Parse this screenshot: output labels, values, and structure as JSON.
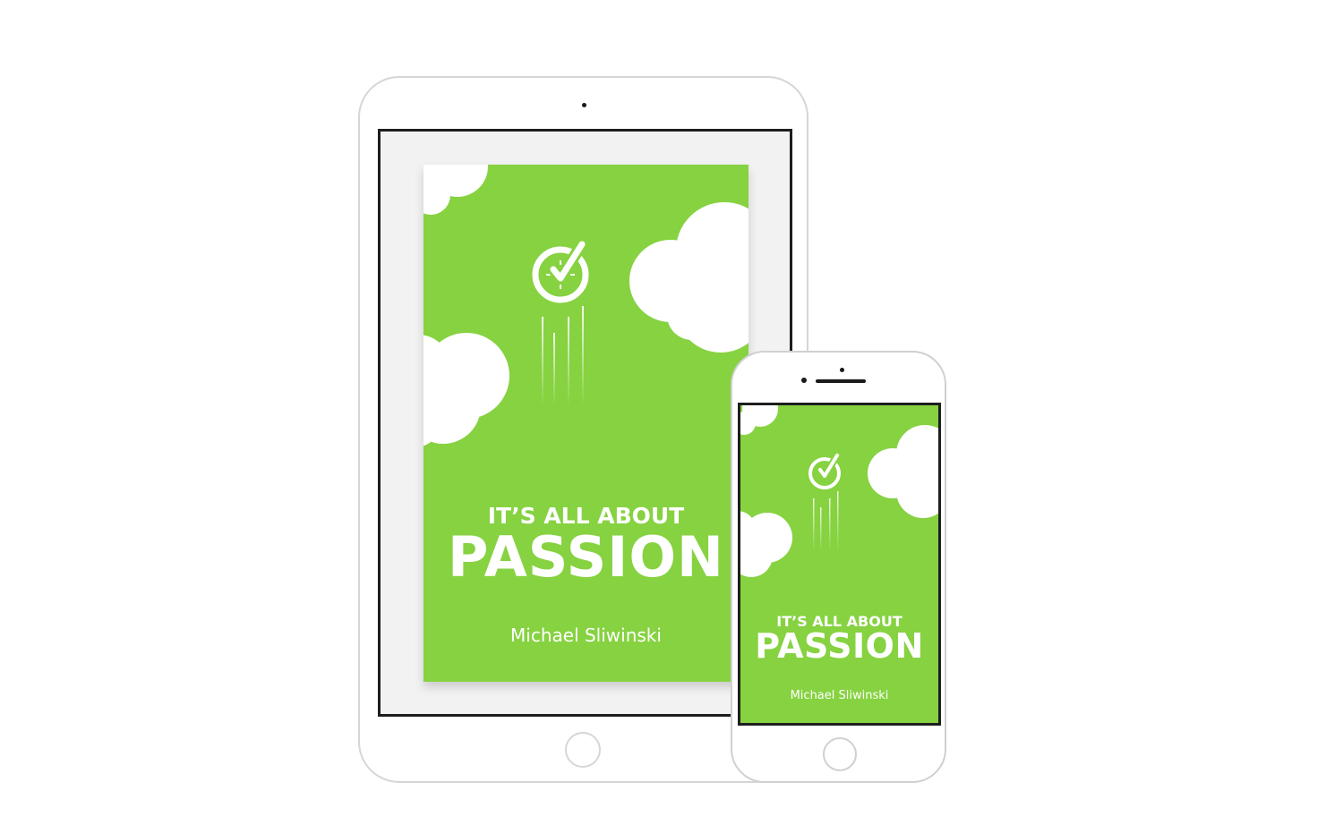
{
  "book": {
    "kicker": "IT’S ALL ABOUT",
    "title": "PASSION",
    "author": "Michael Sliwinski"
  },
  "colors": {
    "cover_green": "#86d241",
    "cloud": "#ffffff",
    "device_outline": "#d6d6d6",
    "screen_border": "#1e1e1e"
  },
  "icons": {
    "logo": "clock-check-icon"
  }
}
